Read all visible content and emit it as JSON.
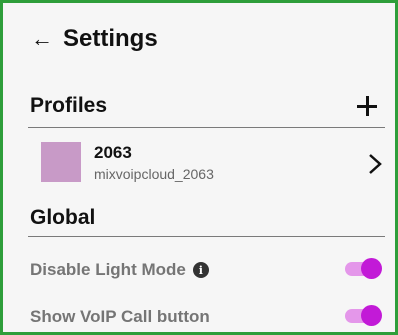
{
  "header": {
    "back_icon": "arrow-left-icon",
    "title": "Settings"
  },
  "profiles": {
    "title": "Profiles",
    "add_icon": "plus-icon",
    "items": [
      {
        "name": "2063",
        "account": "mixvoipcloud_2063",
        "color": "#c89ac7",
        "chevron_icon": "chevron-right-icon"
      }
    ]
  },
  "global": {
    "title": "Global",
    "settings": [
      {
        "label": "Disable Light Mode",
        "info_icon": "info-icon",
        "enabled": true
      },
      {
        "label": "Show VoIP Call button",
        "enabled": true
      }
    ]
  },
  "colors": {
    "accent": "#c21ad7",
    "track": "#e497ea",
    "frame": "#2e9e3a"
  }
}
